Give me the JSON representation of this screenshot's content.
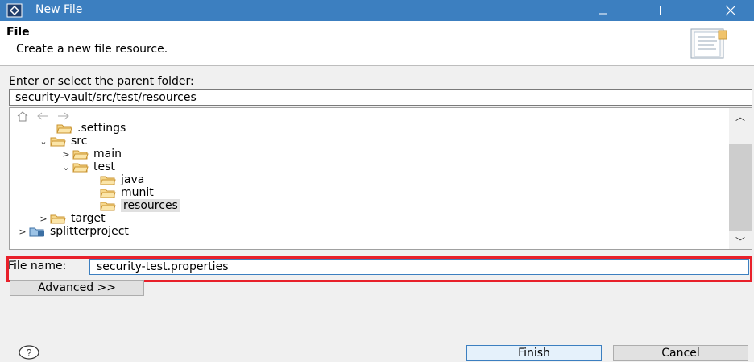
{
  "window": {
    "title": "New File"
  },
  "header": {
    "title": "File",
    "description": "Create a new file resource."
  },
  "parent_folder": {
    "label": "Enter or select the parent folder:",
    "value": "security-vault/src/test/resources"
  },
  "tree": {
    "items": [
      {
        "label": ".settings",
        "expander": ""
      },
      {
        "label": "src",
        "expander": "⌄"
      },
      {
        "label": "main",
        "expander": ">"
      },
      {
        "label": "test",
        "expander": "⌄"
      },
      {
        "label": "java",
        "expander": ""
      },
      {
        "label": "munit",
        "expander": ""
      },
      {
        "label": "resources",
        "expander": "",
        "selected": true
      },
      {
        "label": "target",
        "expander": ">"
      },
      {
        "label": "splitterproject",
        "expander": ">"
      }
    ]
  },
  "file_name": {
    "label": "File name:",
    "value": "security-test.properties"
  },
  "buttons": {
    "advanced": "Advanced >>",
    "finish": "Finish",
    "cancel": "Cancel"
  },
  "colors": {
    "titlebar": "#3c7fc0",
    "highlight_frame": "#e8202a",
    "folder": "#d9a441"
  }
}
